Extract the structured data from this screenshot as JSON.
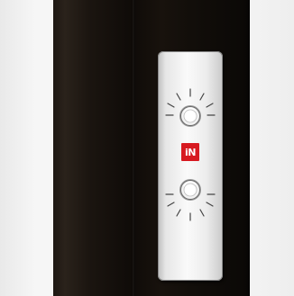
{
  "scene": {
    "description_colors": {
      "background": "#f3f3f3",
      "column": "#15100c",
      "panel": "#e8e8e8",
      "logo": "#d71920"
    }
  },
  "panel": {
    "logo_text": "iN",
    "controls": [
      {
        "name": "upper-dial",
        "icon": "brightness-icon"
      },
      {
        "name": "lower-dial",
        "icon": "brightness-icon"
      }
    ]
  }
}
